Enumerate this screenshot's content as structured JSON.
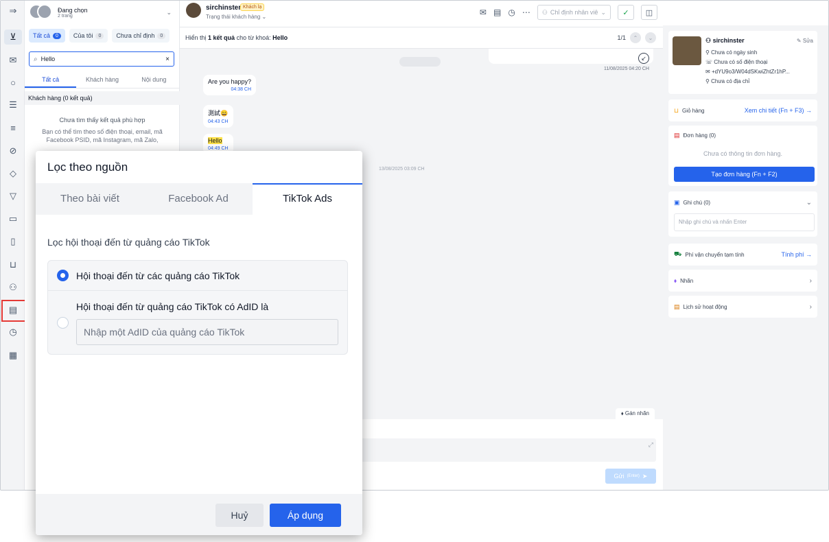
{
  "account": {
    "name": "Đang chọn",
    "sub": "2 trang"
  },
  "filter_tabs": [
    {
      "label": "Tất cả",
      "count": "0"
    },
    {
      "label": "Của tôi",
      "count": "0"
    },
    {
      "label": "Chưa chỉ định",
      "count": "0"
    }
  ],
  "search": {
    "value": "Hello",
    "clear": "×"
  },
  "result_tabs": [
    "Tất cả",
    "Khách hàng",
    "Nội dung"
  ],
  "customers_header": "Khách hàng (0 kết quả)",
  "empty": {
    "title": "Chưa tìm thấy kết quả phù hợp",
    "desc": "Bạn có thể tìm theo số điện thoại, email, mã Facebook PSID, mã Instagram, mã Zalo,"
  },
  "chat": {
    "customer_name": "sirchinster",
    "badge": "Khách lạ",
    "status": "Trạng thái khách hàng",
    "assign_placeholder": "Chỉ định nhân viê",
    "search_info": {
      "prefix": "Hiển thị",
      "count": "1 kết quả",
      "middle": "cho từ khoá:",
      "keyword": "Hello"
    },
    "result_pos": "1/1",
    "top_time": "11/08/2025 04:20 CH",
    "messages": [
      {
        "text": "Are you happy?",
        "time": "04:38 CH"
      },
      {
        "text": "測試😄",
        "time": "04:43 CH"
      },
      {
        "text": "Hello",
        "time": "04:49 CH"
      }
    ],
    "date_separator": "13/08/2025 03:09 CH",
    "label_button": "Gán nhãn",
    "send_label": "Gửi",
    "send_hint": "(Enter)"
  },
  "profile": {
    "name": "sirchinster",
    "edit": "Sửa",
    "birthday": "Chưa có ngày sinh",
    "phone": "Chưa có số điện thoại",
    "id": "+dYU9o3/W04dSKwiZhtZr1hP...",
    "address": "Chưa có địa chỉ"
  },
  "panels": {
    "cart": {
      "label": "Giỏ hàng",
      "link": "Xem chi tiết (Fn + F3)"
    },
    "orders": {
      "label": "Đơn hàng (0)",
      "empty": "Chưa có thông tin đơn hàng.",
      "button": "Tạo đơn hàng (Fn + F2)"
    },
    "notes": {
      "label": "Ghi chú (0)",
      "placeholder": "Nhập ghi chú và nhấn Enter"
    },
    "shipping": {
      "label": "Phí vận chuyển tạm tính",
      "link": "Tính phí"
    },
    "tags": {
      "label": "Nhãn"
    },
    "history": {
      "label": "Lịch sử hoạt động"
    }
  },
  "dialog": {
    "title": "Lọc theo nguồn",
    "tabs": [
      "Theo bài viết",
      "Facebook Ad",
      "TikTok Ads"
    ],
    "subtitle": "Lọc hội thoại đến từ quảng cáo TikTok",
    "option_all": "Hội thoại đến từ các quảng cáo TikTok",
    "option_adid": "Hội thoại đến từ quảng cáo TikTok có AdID là",
    "adid_placeholder": "Nhập một AdID của quảng cáo TikTok",
    "cancel": "Huỷ",
    "apply": "Áp dụng"
  },
  "colors": {
    "accent": "#2563eb",
    "highlight_box": "#e53935"
  }
}
